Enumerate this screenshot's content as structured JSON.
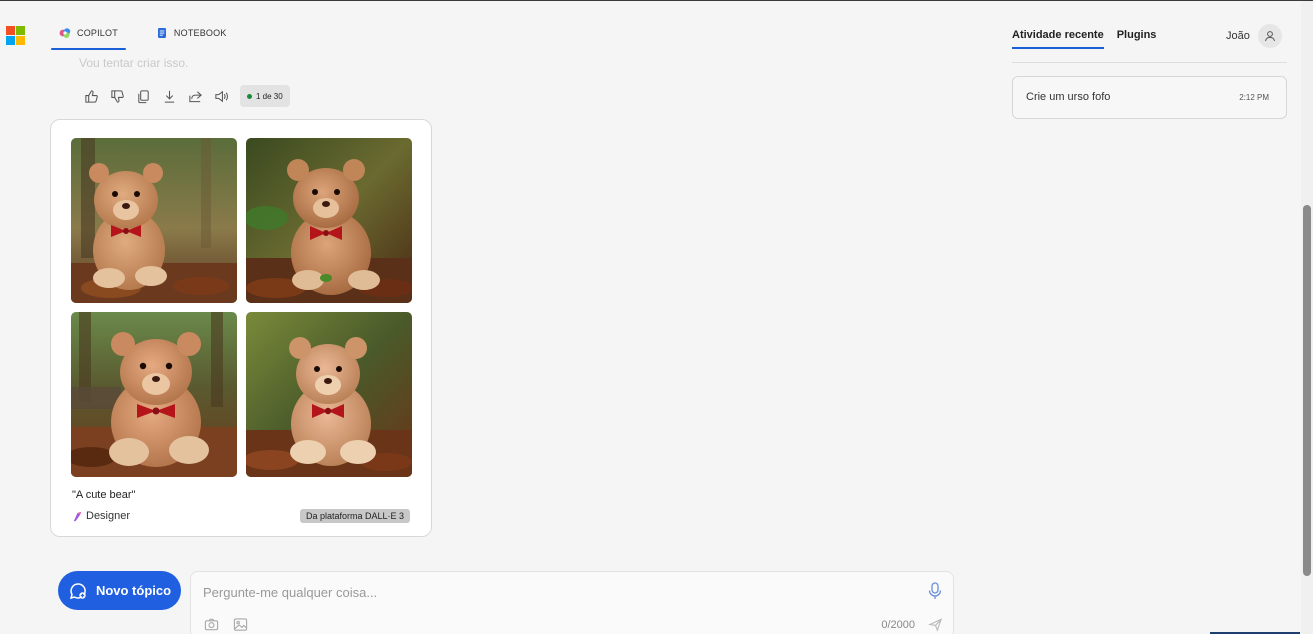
{
  "logo": {
    "colors": [
      "#f25022",
      "#7fba00",
      "#00a4ef",
      "#ffb900"
    ]
  },
  "tabs": [
    {
      "label": "COPILOT",
      "icon": "copilot-icon",
      "active": true
    },
    {
      "label": "NOTEBOOK",
      "icon": "notebook-icon",
      "active": false
    }
  ],
  "chat": {
    "faded_message": "Vou tentar criar isso.",
    "actions": [
      "thumbs-up-icon",
      "thumbs-down-icon",
      "copy-icon",
      "download-icon",
      "share-icon",
      "speaker-icon"
    ],
    "counter": "1 de 30"
  },
  "image_card": {
    "caption": "\"A cute bear\"",
    "designer_label": "Designer",
    "platform_badge": "Da plataforma DALL·E 3",
    "images": [
      "teddy-bear-image-1",
      "teddy-bear-image-2",
      "teddy-bear-image-3",
      "teddy-bear-image-4"
    ]
  },
  "composer": {
    "new_topic_label": "Novo tópico",
    "placeholder": "Pergunte-me qualquer coisa...",
    "char_count": "0/2000"
  },
  "right_panel": {
    "tabs": [
      {
        "label": "Atividade recente",
        "active": true
      },
      {
        "label": "Plugins",
        "active": false
      }
    ],
    "user_name": "João",
    "history": [
      {
        "title": "Crie um urso fofo",
        "time": "2:12 PM"
      }
    ]
  },
  "colors": {
    "accent": "#1f5fe0",
    "tab_underline": "#1a5ed8",
    "bow_red": "#b3151b"
  }
}
